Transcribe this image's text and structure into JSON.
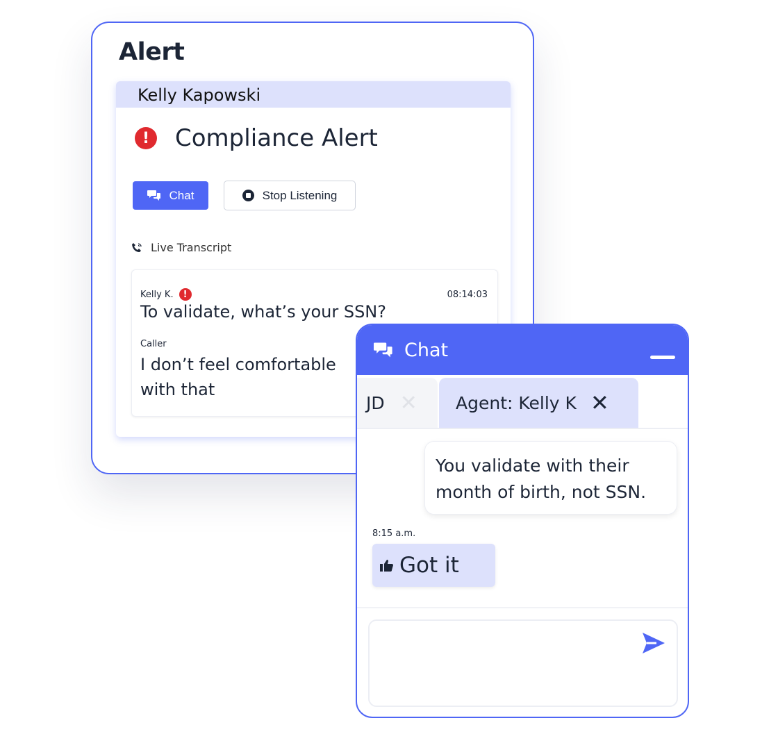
{
  "alert": {
    "title": "Alert",
    "agent_name": "Kelly Kapowski",
    "alert_type": "Compliance Alert",
    "alert_icon": "exclamation-circle-icon",
    "chat_button_label": "Chat",
    "stop_button_label": "Stop Listening",
    "transcript_label": "Live Transcript",
    "transcript": [
      {
        "speaker": "Kelly K.",
        "flagged": true,
        "time": "08:14:03",
        "text": "To validate, what’s your SSN?"
      },
      {
        "speaker": "Caller",
        "flagged": false,
        "text": "I don’t feel comfortable with that"
      }
    ]
  },
  "chat": {
    "title": "Chat",
    "tabs": [
      {
        "label": "JD",
        "active": false
      },
      {
        "label": "Agent: Kelly K",
        "active": true
      }
    ],
    "messages": [
      {
        "direction": "outgoing",
        "text": "You validate with their month of birth, not SSN."
      },
      {
        "direction": "incoming",
        "time": "8:15 a.m.",
        "icon": "thumbs-up-icon",
        "text": "Got it"
      }
    ],
    "composer_placeholder": ""
  },
  "colors": {
    "accent": "#4f66f5",
    "accent_light": "#dde1fc",
    "alert_red": "#e02a2f",
    "text_dark": "#1c2536"
  }
}
